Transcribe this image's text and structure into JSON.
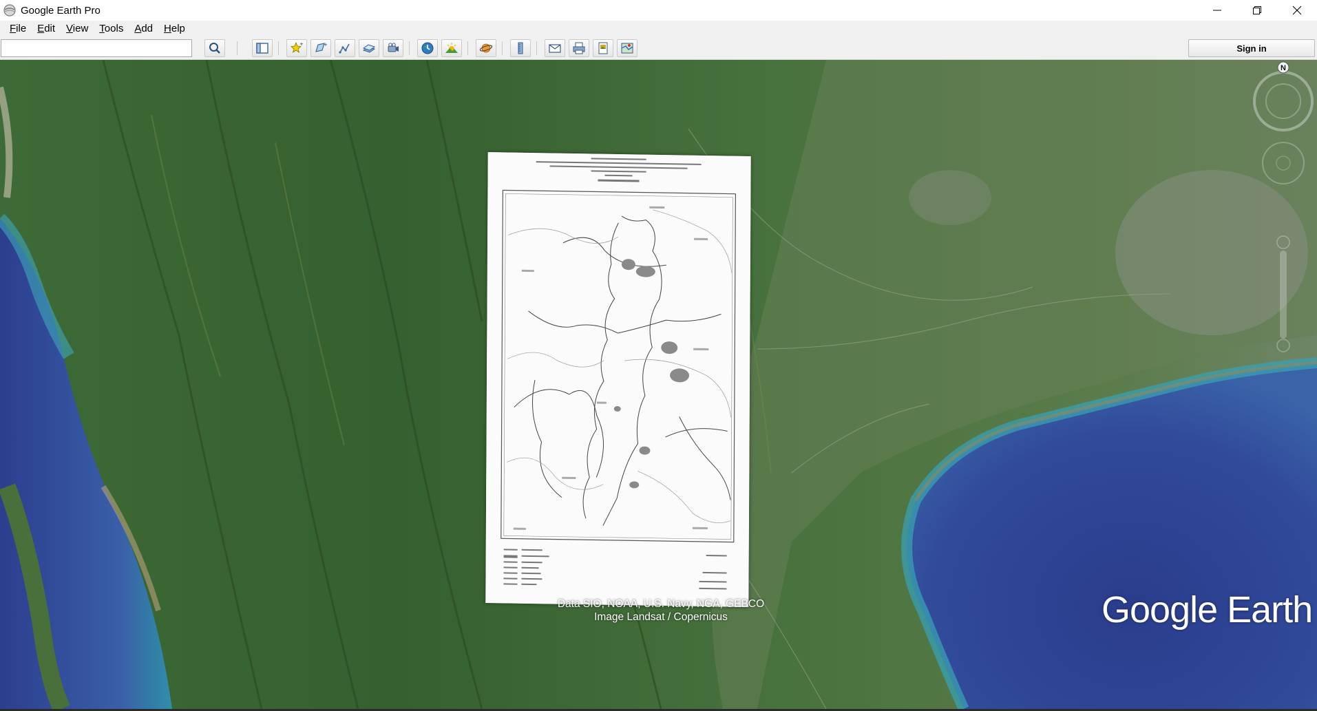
{
  "window": {
    "title": "Google Earth Pro",
    "icon": "google-earth-globe-icon",
    "controls": [
      "minimize-icon",
      "restore-icon",
      "close-icon"
    ]
  },
  "menu": {
    "items": [
      {
        "label": "File",
        "underline": "F",
        "rest": "ile"
      },
      {
        "label": "Edit",
        "underline": "E",
        "rest": "dit"
      },
      {
        "label": "View",
        "underline": "V",
        "rest": "iew"
      },
      {
        "label": "Tools",
        "underline": "T",
        "rest": "ools"
      },
      {
        "label": "Add",
        "underline": "A",
        "rest": "dd"
      },
      {
        "label": "Help",
        "underline": "H",
        "rest": "elp"
      }
    ]
  },
  "toolbar": {
    "search": {
      "value": "",
      "placeholder": ""
    },
    "buttons": [
      "search-icon",
      "sidebar-toggle-icon",
      "add-placemark-icon",
      "add-polygon-icon",
      "add-path-icon",
      "add-image-overlay-icon",
      "record-tour-icon",
      "historical-imagery-icon",
      "sunlight-icon",
      "planets-icon",
      "ruler-icon",
      "email-icon",
      "print-icon",
      "save-image-icon",
      "view-in-maps-icon"
    ],
    "sign_in_label": "Sign in"
  },
  "map": {
    "compass_label": "N",
    "attribution_line1": "Data SIO, NOAA, U.S. Navy, NGA, GEBCO",
    "attribution_line2": "Image Landsat / Copernicus",
    "logo_text": "Google Earth",
    "overlay": "scanned-map-image-overlay"
  }
}
